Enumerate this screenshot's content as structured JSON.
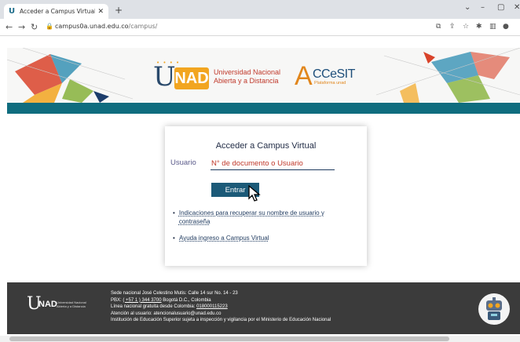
{
  "browser": {
    "tab_title": "Acceder a Campus Virtual - Univ",
    "tab_close": "✕",
    "new_tab": "+",
    "url_host": "campus0a.unad.edu.co",
    "url_path": "/campus/",
    "window_controls": [
      "⌄",
      "–",
      "▢",
      "✕"
    ]
  },
  "header": {
    "logo_u": "U",
    "logo_nad": "NAD",
    "university_line1": "Universidad Nacional",
    "university_line2": "Abierta y a Distancia",
    "accesit_a": "A",
    "accesit_title": "CCeSIT",
    "accesit_subtitle": "Plataforma unad"
  },
  "login": {
    "title": "Acceder a Campus Virtual",
    "user_label": "Usuario",
    "user_placeholder": "N° de documento o Usuario",
    "enter_button": "Entrar",
    "links": [
      "Indicaciones para recuperar su nombre de usuario y contraseña",
      "Ayuda ingreso a Campus Virtual"
    ]
  },
  "footer": {
    "logo_u": "U",
    "logo_nad": "NAD",
    "logo_text_line1": "Universidad Nacional",
    "logo_text_line2": "Abierta y a Distancia",
    "address": "Sede nacional José Celestino Mutis: Calle 14 sur No. 14 - 23",
    "pbx_prefix": "PBX: ",
    "pbx_number": "( +57 1 ) 344 3700",
    "pbx_suffix": " Bogotá D.C., Colombia",
    "free_line_prefix": "Línea nacional gratuita desde Colombia: ",
    "free_line_number": "018000115223",
    "attention": "Atención al usuario: atencionalusuario@unad.edu.co",
    "institution": "Institución de Educación Superior sujeta a inspección y vigilancia por el Ministerio de Educación Nacional"
  },
  "colors": {
    "teal_band": "#0f6d7f",
    "button": "#1c5a78",
    "placeholder_red": "#c0392b",
    "footer_bg": "#3b3b3b",
    "accent_orange": "#f2a520"
  }
}
